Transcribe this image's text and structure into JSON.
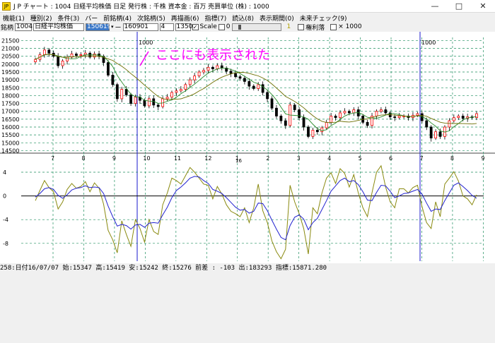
{
  "window": {
    "title": "J P チャート : 1004 日経平均株価  日足   発行株 : 千株  資本金 : 百万  売買単位 (株) : 1000",
    "icon_text": "JP"
  },
  "menu": [
    "機能(1)",
    "種別(2)",
    "条件(3)",
    "バー",
    "前銘柄(4)",
    "次銘柄(5)",
    "再描画(6)",
    "指標(7)",
    "読込(8)",
    "表示期間(0)",
    "未来チェック(9)"
  ],
  "toolbar": {
    "label": "銘柄",
    "code": "1004",
    "name": "日経平均株価",
    "date_from": "150619",
    "dash": "ー",
    "date_to": "160901",
    "param1": "4",
    "param2": "1350",
    "scale_check": "✓",
    "scale_label": "Scale",
    "zero_label": "0",
    "page_value": "1",
    "rights_label": "権利落",
    "x1000_label": "× 1000"
  },
  "annotation": "ここにも表示された",
  "status_text": "258:日付16/07/07 始:15347 高:15419 安:15242 終:15276 前差 : -103 出:183293 指標:15871.280",
  "colors": {
    "up": "#ff0000",
    "down": "#000000",
    "ma_short": "#2a8a2a",
    "ma_long": "#6e6e00",
    "osc1": "#8a8a10",
    "osc2": "#2323d0",
    "marker": "#1a1acc",
    "annot": "#ff00ff"
  },
  "chart_data": [
    {
      "type": "candlestick",
      "y_ticks": [
        21500,
        21000,
        20500,
        20000,
        19500,
        19000,
        18500,
        18000,
        17500,
        17000,
        16500,
        16000,
        15500,
        15000,
        14500
      ],
      "ylim": [
        14250,
        21700
      ],
      "x_tick_labels": [
        "7",
        "8",
        "9",
        "10",
        "11",
        "12",
        "1",
        "2",
        "3",
        "4",
        "5",
        "6",
        "7",
        "8",
        "9"
      ],
      "year_label": "16",
      "marker_labels": [
        "1000",
        "1000"
      ],
      "closes": [
        20300,
        20600,
        20900,
        20700,
        20500,
        19900,
        20200,
        20450,
        20650,
        20550,
        20600,
        20700,
        20450,
        20650,
        20500,
        20100,
        19300,
        18700,
        17800,
        18400,
        18050,
        17500,
        17900,
        17700,
        17350,
        17800,
        17400,
        17300,
        17800,
        17900,
        18200,
        18300,
        18400,
        18700,
        19000,
        19250,
        19500,
        19600,
        19800,
        19700,
        19900,
        19750,
        19550,
        19400,
        19200,
        19100,
        18900,
        18600,
        18450,
        18700,
        18200,
        17800,
        17200,
        16700,
        16400,
        16100,
        17400,
        17100,
        16600,
        16000,
        15400,
        15800,
        15700,
        15950,
        16300,
        16700,
        16600,
        16900,
        17000,
        16900,
        17100,
        16700,
        16300,
        16100,
        16700,
        17000,
        17100,
        16900,
        16650,
        16600,
        16700,
        16700,
        16600,
        16750,
        16850,
        16400,
        16000,
        15300,
        15700,
        15400,
        16000,
        16400,
        16600,
        16700,
        16550,
        16650,
        16600,
        16850
      ]
    },
    {
      "type": "line",
      "y_ticks": [
        4,
        0,
        -4,
        -8
      ],
      "ylim": [
        -11,
        6.5
      ],
      "series": [
        {
          "values": [
            -0.8,
            0.9,
            2.6,
            1.4,
            0.7,
            -2.2,
            -1.0,
            1.1,
            2.1,
            1.3,
            1.6,
            2.4,
            0.7,
            2.2,
            1.3,
            -1.4,
            -5.8,
            -7.4,
            -9.6,
            -4.2,
            -6.5,
            -8.5,
            -4.0,
            -5.5,
            -7.8,
            -4.0,
            -6.0,
            -6.5,
            -1.5,
            0.5,
            3.0,
            2.6,
            2.0,
            3.4,
            4.8,
            4.0,
            3.0,
            2.0,
            1.8,
            -0.5,
            1.6,
            0.3,
            -1.5,
            -2.6,
            -3.0,
            -3.5,
            -2.0,
            -4.5,
            -2.0,
            2.0,
            -2.5,
            -4.5,
            -7.6,
            -9.4,
            -10.6,
            -9.0,
            1.8,
            -1.0,
            -3.0,
            -5.5,
            -9.8,
            -2.0,
            -3.0,
            0.5,
            3.0,
            3.9,
            2.1,
            4.6,
            3.8,
            1.5,
            3.6,
            0.5,
            -2.0,
            -3.5,
            0.5,
            4.0,
            5.1,
            1.5,
            -1.0,
            -2.0,
            1.2,
            1.2,
            0.5,
            1.4,
            1.8,
            -1.8,
            -4.5,
            -5.5,
            -1.0,
            -3.5,
            2.0,
            3.0,
            4.1,
            2.5,
            0.0,
            -0.5,
            -1.5,
            0.2
          ]
        },
        {
          "values": [
            -0.2,
            0.4,
            1.2,
            1.4,
            1.1,
            0.1,
            -0.4,
            0.2,
            1.0,
            1.3,
            1.4,
            1.7,
            1.4,
            1.5,
            1.4,
            0.4,
            -1.7,
            -3.5,
            -5.1,
            -4.8,
            -5.0,
            -5.6,
            -4.9,
            -4.8,
            -5.3,
            -4.6,
            -4.5,
            -4.6,
            -3.2,
            -1.9,
            -0.3,
            0.9,
            1.5,
            2.2,
            3.0,
            3.3,
            3.2,
            2.6,
            2.1,
            1.1,
            0.8,
            0.4,
            -0.3,
            -1.1,
            -1.9,
            -2.4,
            -2.3,
            -2.9,
            -2.6,
            -1.2,
            -1.3,
            -2.5,
            -4.1,
            -5.6,
            -7.0,
            -7.4,
            -5.0,
            -3.6,
            -3.2,
            -3.9,
            -5.7,
            -4.5,
            -3.8,
            -2.3,
            -0.8,
            0.8,
            1.7,
            2.6,
            3.0,
            2.4,
            2.6,
            1.9,
            0.7,
            -0.7,
            -0.8,
            0.6,
            1.8,
            1.7,
            0.8,
            -0.3,
            0.0,
            0.4,
            0.5,
            0.8,
            1.1,
            0.3,
            -1.2,
            -2.6,
            -2.2,
            -2.3,
            -0.8,
            0.5,
            1.8,
            2.2,
            1.6,
            0.9,
            0.1,
            -0.4
          ]
        }
      ]
    }
  ]
}
